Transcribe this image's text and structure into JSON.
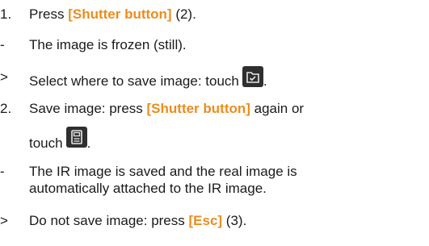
{
  "steps": [
    {
      "marker": "1.",
      "pre": "Press ",
      "highlight": "[Shutter button]",
      "post": " (2)."
    },
    {
      "marker": "-",
      "text": "The image is frozen (still)."
    },
    {
      "marker": ">",
      "text": "Select where to save image: touch",
      "icon": "folder-check-icon",
      "after_icon": "."
    },
    {
      "marker": "2.",
      "pre": "Save image: press ",
      "highlight": "[Shutter button]",
      "post": " again or",
      "line2": "touch",
      "icon": "save-icon",
      "after_icon": "."
    },
    {
      "marker": "-",
      "text": "The IR image is saved and the real image is",
      "line2": "automatically attached to the IR image."
    },
    {
      "marker": ">",
      "pre": "Do not save image: press ",
      "highlight": "[Esc]",
      "post": " (3)."
    }
  ],
  "colors": {
    "highlight": "#ec8c1c",
    "text": "#1a1a1a",
    "icon_bg": "#2f2f2f"
  }
}
